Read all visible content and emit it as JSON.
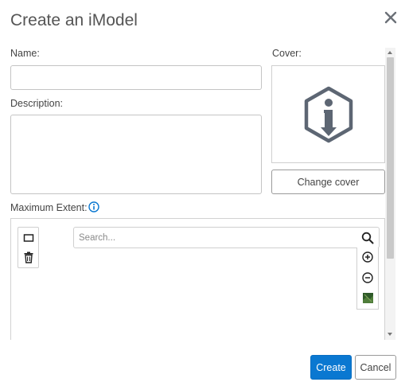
{
  "dialog": {
    "title": "Create an iModel",
    "close_icon": "close-icon"
  },
  "form": {
    "name_label": "Name:",
    "name_value": "",
    "description_label": "Description:",
    "description_value": "",
    "extent_label": "Maximum Extent:",
    "extent_info_icon": "info-icon"
  },
  "cover": {
    "label": "Cover:",
    "image_icon": "info-hexagon-icon",
    "change_button": "Change cover"
  },
  "map": {
    "search_placeholder": "Search...",
    "tools": [
      "rectangle-select-icon",
      "trash-icon"
    ],
    "controls": [
      "zoom-in-icon",
      "zoom-out-icon",
      "basemap-icon"
    ]
  },
  "actions": {
    "create_label": "Create",
    "cancel_label": "Cancel"
  },
  "colors": {
    "primary": "#0a78d1",
    "icon_gray": "#5d6673",
    "text": "#555555"
  }
}
